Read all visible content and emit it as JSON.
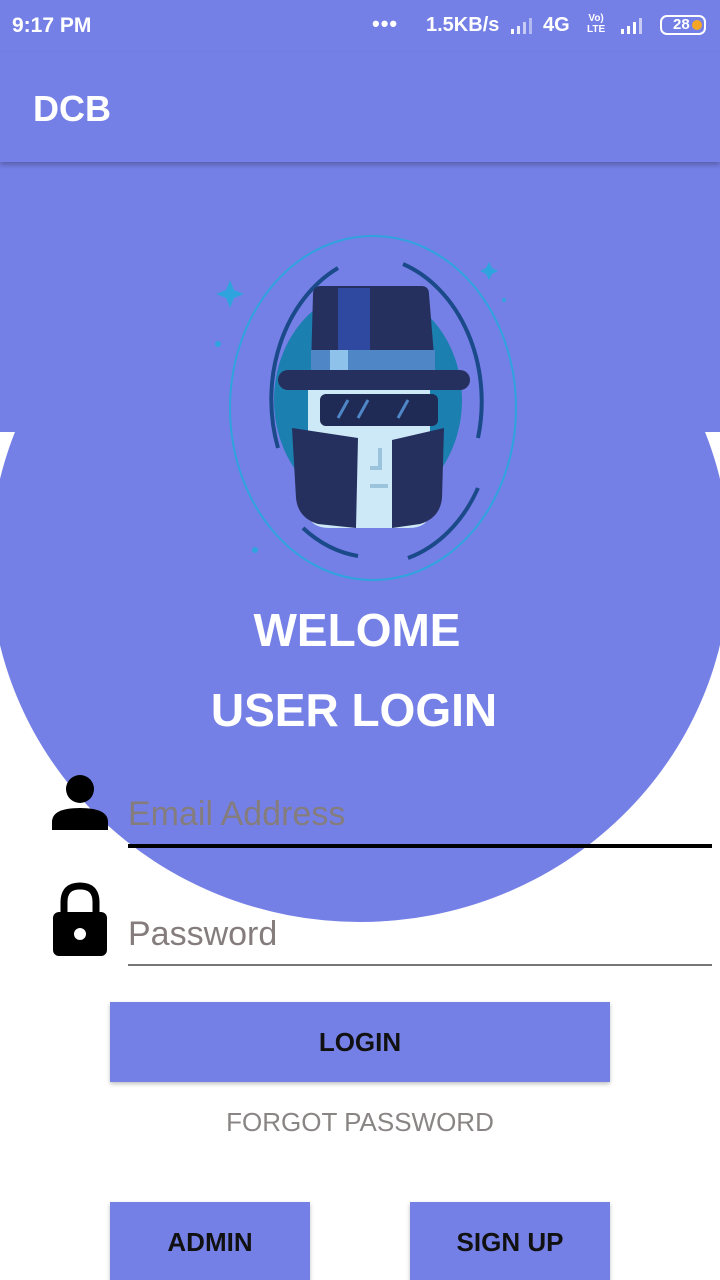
{
  "status_bar": {
    "time": "9:17 PM",
    "dots": "•••",
    "speed": "1.5KB/s",
    "network": "4G",
    "volte_top": "Vo)",
    "volte_bottom": "LTE",
    "battery": "28"
  },
  "app_bar": {
    "title": "DCB"
  },
  "header": {
    "welcome": "WELOME",
    "title": "USER LOGIN"
  },
  "form": {
    "email_placeholder": "Email Address",
    "password_placeholder": "Password",
    "login_label": "LOGIN",
    "forgot_label": "FORGOT PASSWORD",
    "admin_label": "ADMIN",
    "signup_label": "SIGN UP"
  },
  "icons": {
    "user": "person-icon",
    "lock": "lock-icon",
    "hero": "spy-agent-icon"
  },
  "colors": {
    "primary": "#7580e6",
    "button_text": "#111111",
    "hint_text": "#857d7d"
  }
}
